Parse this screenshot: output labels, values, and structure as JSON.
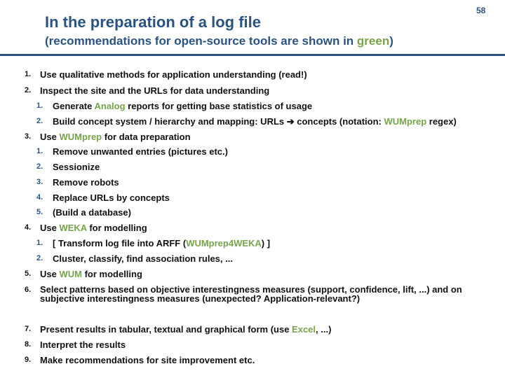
{
  "header": {
    "title": "In the preparation of a log file",
    "subtitle_before": "(recommendations for open-source tools are shown in ",
    "subtitle_green": "green",
    "subtitle_after": ")",
    "page_number": "58"
  },
  "colors": {
    "title_blue": "#2a5381",
    "tool_green": "#77a34a",
    "body_text": "#111111"
  },
  "list": {
    "i1": {
      "num": "1.",
      "text": "Use qualitative methods for application understanding (read!)"
    },
    "i2": {
      "num": "2.",
      "text": "Inspect the site and the URLs for data understanding"
    },
    "i2_1": {
      "num": "1.",
      "pre": "Generate ",
      "tool": "Analog",
      "post": " reports for getting base statistics of usage"
    },
    "i2_2": {
      "num": "2.",
      "pre": "Build concept system / hierarchy and mapping: URLs ",
      "arrow": "➔",
      "mid": " concepts (notation: ",
      "tool": "WUMprep",
      "post": " regex)"
    },
    "i3": {
      "num": "3.",
      "pre": "Use ",
      "tool": "WUMprep",
      "post": " for data preparation"
    },
    "i3_1": {
      "num": "1.",
      "text": "Remove unwanted entries (pictures etc.)"
    },
    "i3_2": {
      "num": "2.",
      "text": "Sessionize"
    },
    "i3_3": {
      "num": "3.",
      "text": "Remove robots"
    },
    "i3_4": {
      "num": "4.",
      "text": "Replace URLs by concepts"
    },
    "i3_5": {
      "num": "5.",
      "text": "(Build a database)"
    },
    "i4": {
      "num": "4.",
      "pre": "Use ",
      "tool": "WEKA",
      "post": " for modelling"
    },
    "i4_1": {
      "num": "1.",
      "pre": "[ Transform log file into ARFF (",
      "tool": "WUMprep4WEKA",
      "post": ") ]"
    },
    "i4_2": {
      "num": "2.",
      "text": "Cluster, classify, find association rules, ..."
    },
    "i5": {
      "num": "5.",
      "pre": "Use ",
      "tool": "WUM",
      "post": " for modelling"
    },
    "i6": {
      "num": "6.",
      "text": "Select patterns based on objective interestingness measures (support, confidence, lift, ...) and on subjective interestingness measures (unexpected? Application-relevant?)"
    },
    "i7": {
      "num": "7.",
      "pre": "Present results in tabular, textual and graphical form (use ",
      "tool": "Excel",
      "post": ", ...)"
    },
    "i8": {
      "num": "8.",
      "text": "Interpret the results"
    },
    "i9": {
      "num": "9.",
      "text": "Make recommendations for site improvement etc."
    }
  }
}
